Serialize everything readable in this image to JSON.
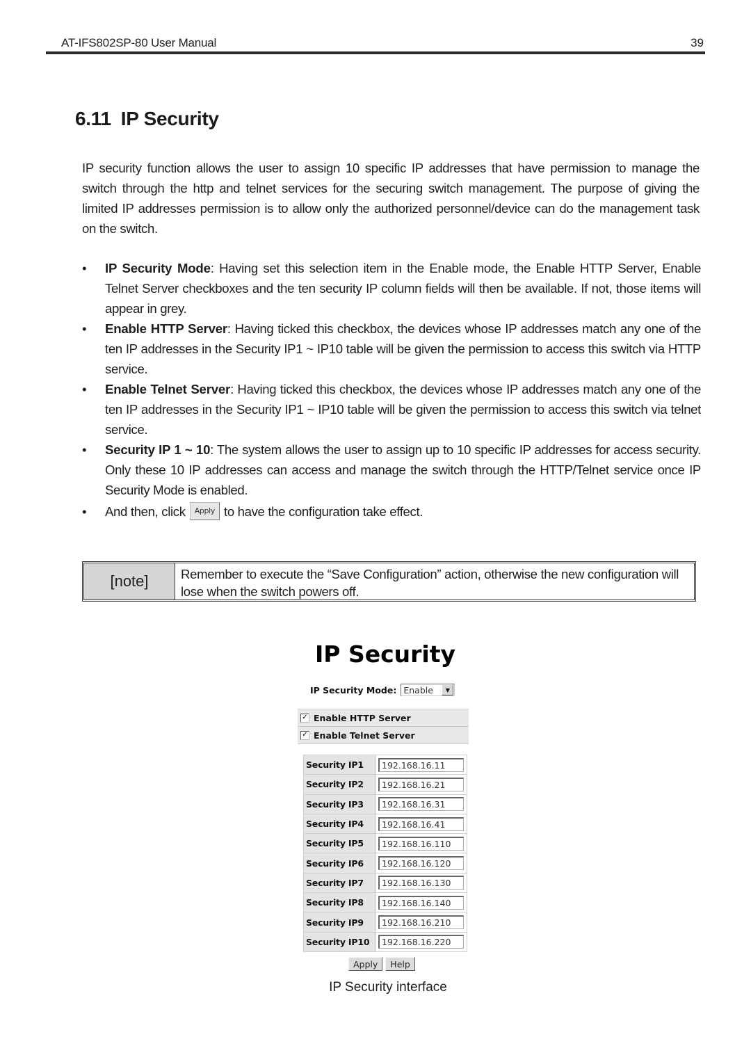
{
  "header": {
    "title": "AT-IFS802SP-80 User Manual",
    "page_number": "39"
  },
  "section": {
    "number": "6.11",
    "title": "IP Security"
  },
  "intro": "IP security function allows the user to assign 10 specific IP addresses that have permission to manage the switch through the http and telnet services for the securing switch management. The purpose of giving the limited IP addresses permission is to allow only the authorized personnel/device can do the management task on the switch.",
  "bullets": [
    {
      "term": "IP Security Mode",
      "text": ": Having set this selection item in the Enable mode, the Enable HTTP Server, Enable Telnet Server checkboxes and the ten security IP column fields will then be available. If not, those items will appear in grey."
    },
    {
      "term": "Enable HTTP Server",
      "text": ": Having ticked this checkbox, the devices whose IP addresses match any one of the ten IP addresses in the Security IP1 ~ IP10 table will be given the permission to access this switch via HTTP service."
    },
    {
      "term": "Enable Telnet Server",
      "text": ": Having ticked this checkbox, the devices whose IP addresses match any one of the ten IP addresses in the Security IP1 ~ IP10 table will be given the permission to access this switch via telnet service."
    },
    {
      "term": "Security IP 1 ~ 10",
      "text": ": The system allows the user to assign up to 10 specific IP addresses for access security. Only these 10 IP addresses can access and manage the switch through the HTTP/Telnet service once IP Security Mode is enabled."
    }
  ],
  "last_bullet": {
    "before": "And then, click",
    "button": "Apply",
    "after": "to have the configuration take effect."
  },
  "bullet_char": "•",
  "note": {
    "label": "[note]",
    "text": "Remember to execute the “Save Configuration” action, otherwise the new configuration will lose when the switch powers off."
  },
  "ui": {
    "title": "IP Security",
    "mode_label": "IP Security Mode:",
    "mode_value": "Enable",
    "dropdown_arrow": "▼",
    "checkmark": "✓",
    "checkboxes": [
      {
        "label": "Enable HTTP Server",
        "checked": true
      },
      {
        "label": "Enable Telnet Server",
        "checked": true
      }
    ],
    "ips": [
      {
        "label": "Security IP1",
        "value": "192.168.16.11"
      },
      {
        "label": "Security IP2",
        "value": "192.168.16.21"
      },
      {
        "label": "Security IP3",
        "value": "192.168.16.31"
      },
      {
        "label": "Security IP4",
        "value": "192.168.16.41"
      },
      {
        "label": "Security IP5",
        "value": "192.168.16.110"
      },
      {
        "label": "Security IP6",
        "value": "192.168.16.120"
      },
      {
        "label": "Security IP7",
        "value": "192.168.16.130"
      },
      {
        "label": "Security IP8",
        "value": "192.168.16.140"
      },
      {
        "label": "Security IP9",
        "value": "192.168.16.210"
      },
      {
        "label": "Security IP10",
        "value": "192.168.16.220"
      }
    ],
    "apply_label": "Apply",
    "help_label": "Help"
  },
  "caption": "IP Security interface"
}
